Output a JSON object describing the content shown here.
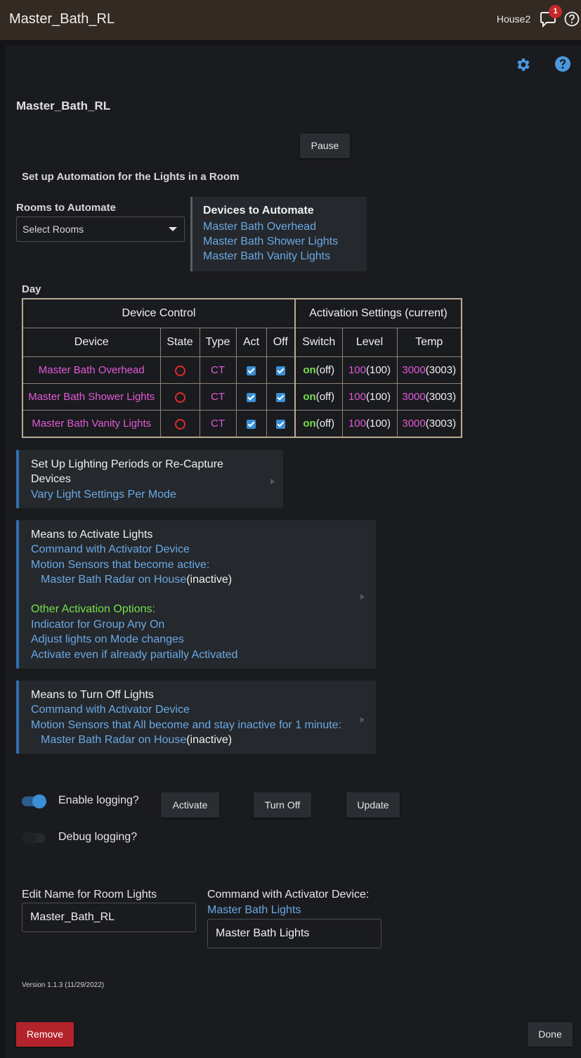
{
  "header": {
    "title": "Master_Bath_RL",
    "hub": "House2",
    "notification_count": "1",
    "icons": [
      "notification-icon",
      "help-circle-icon"
    ]
  },
  "toolbar": {
    "icons": [
      "gear-icon",
      "help-icon"
    ]
  },
  "page_title": "Master_Bath_RL",
  "pause_label": "Pause",
  "subtitle": "Set up Automation for the Lights in a Room",
  "rooms": {
    "label": "Rooms to Automate",
    "placeholder": "Select Rooms"
  },
  "devices_box": {
    "heading": "Devices to Automate",
    "items": [
      "Master Bath Overhead",
      "Master Bath Shower Lights",
      "Master Bath Vanity Lights"
    ]
  },
  "day_label": "Day",
  "table": {
    "group_headers": [
      "Device Control",
      "Activation Settings (current)"
    ],
    "columns": [
      "Device",
      "State",
      "Type",
      "Act",
      "Off",
      "Switch",
      "Level",
      "Temp"
    ],
    "rows": [
      {
        "device": "Master Bath Overhead",
        "type": "CT",
        "act": true,
        "off": true,
        "switch_set": "on",
        "switch_cur": "(off)",
        "level_set": "100",
        "level_cur": "(100)",
        "temp_set": "3000",
        "temp_cur": "(3003)"
      },
      {
        "device": "Master Bath Shower Lights",
        "type": "CT",
        "act": true,
        "off": true,
        "switch_set": "on",
        "switch_cur": "(off)",
        "level_set": "100",
        "level_cur": "(100)",
        "temp_set": "3000",
        "temp_cur": "(3003)"
      },
      {
        "device": "Master Bath Vanity Lights",
        "type": "CT",
        "act": true,
        "off": true,
        "switch_set": "on",
        "switch_cur": "(off)",
        "level_set": "100",
        "level_cur": "(100)",
        "temp_set": "3000",
        "temp_cur": "(3003)"
      }
    ]
  },
  "periods": {
    "title_line1": "Set Up Lighting Periods or Re-Capture",
    "title_line2": "Devices",
    "sub": "Vary Light Settings Per Mode"
  },
  "activate": {
    "title": "Means to Activate Lights",
    "line1": "Command with Activator Device",
    "line2": "Motion Sensors that become active:",
    "sensor": "Master Bath Radar on House",
    "sensor_state": "(inactive)",
    "other_heading": "Other Activation Options",
    "other_colon": ":",
    "opt1": "Indicator for Group Any On",
    "opt2": "Adjust lights on Mode changes",
    "opt3": "Activate even if already partially Activated"
  },
  "turnoff": {
    "title": "Means to Turn Off Lights",
    "line1": "Command with Activator Device",
    "line2": "Motion Sensors that All become and stay inactive for 1 minute:",
    "sensor": "Master Bath Radar on House",
    "sensor_state": "(inactive)"
  },
  "logging": {
    "enable_label": "Enable logging?",
    "enable_on": true,
    "debug_label": "Debug logging?",
    "debug_on": false
  },
  "buttons": {
    "activate": "Activate",
    "turn_off": "Turn Off",
    "update": "Update",
    "remove": "Remove",
    "done": "Done"
  },
  "edit_name": {
    "label": "Edit Name for Room Lights",
    "value": "Master_Bath_RL"
  },
  "activator": {
    "label": "Command with Activator Device:",
    "link": "Master Bath Lights",
    "value": "Master Bath Lights"
  },
  "version": "Version 1.1.3 (11/29/2022)",
  "colors": {
    "accent_blue": "#3a8fd6",
    "link_blue": "#6aa9e6",
    "magenta": "#e05ad8",
    "green": "#74e04a",
    "danger_red": "#b3232c"
  }
}
